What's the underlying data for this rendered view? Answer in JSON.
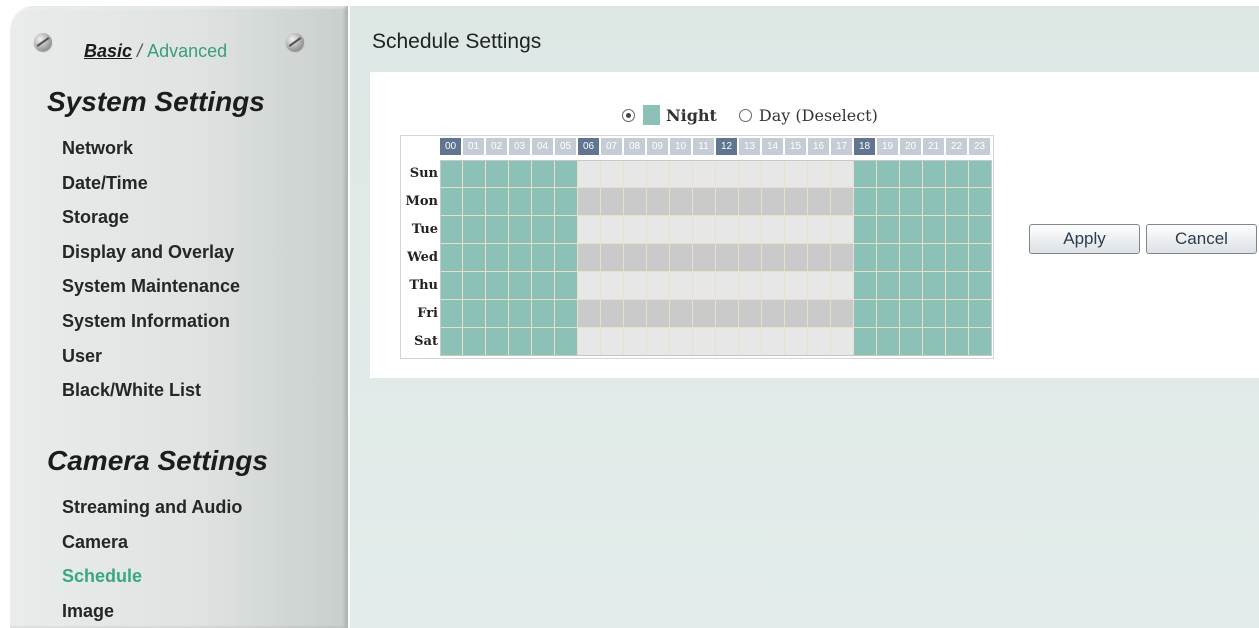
{
  "sidebar": {
    "mode": {
      "basic": "Basic",
      "separator": " / ",
      "advanced": "Advanced"
    },
    "system_title": "System Settings",
    "system_items": [
      "Network",
      "Date/Time",
      "Storage",
      "Display and Overlay",
      "System Maintenance",
      "System Information",
      "User",
      "Black/White List"
    ],
    "camera_title": "Camera Settings",
    "camera_items": [
      "Streaming and Audio",
      "Camera",
      "Schedule",
      "Image"
    ],
    "active_item": "Schedule"
  },
  "main": {
    "title": "Schedule Settings",
    "legend": {
      "night_label": "Night",
      "day_label": "Day (Deselect)",
      "selected": "night"
    },
    "hours": [
      "00",
      "01",
      "02",
      "03",
      "04",
      "05",
      "06",
      "07",
      "08",
      "09",
      "10",
      "11",
      "12",
      "13",
      "14",
      "15",
      "16",
      "17",
      "18",
      "19",
      "20",
      "21",
      "22",
      "23"
    ],
    "highlighted_hours": [
      "00",
      "06",
      "12",
      "18"
    ],
    "days": [
      "Sun",
      "Mon",
      "Tue",
      "Wed",
      "Thu",
      "Fri",
      "Sat"
    ],
    "night_hours": [
      0,
      1,
      2,
      3,
      4,
      5,
      18,
      19,
      20,
      21,
      22,
      23
    ],
    "apply_label": "Apply",
    "cancel_label": "Cancel"
  },
  "colors": {
    "night": "#8cc1b7",
    "day_light": "#e7e7e7",
    "day_dark": "#cacaca",
    "active_nav": "#3aa783"
  }
}
